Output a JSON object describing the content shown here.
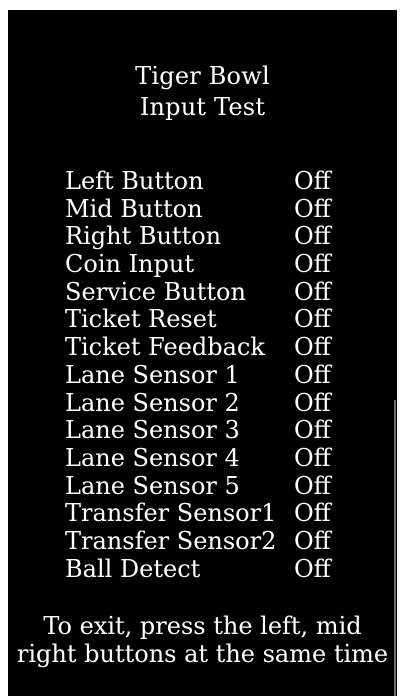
{
  "title": {
    "line1": "Tiger Bowl",
    "line2": "Input Test"
  },
  "inputs": [
    {
      "label": "Left Button",
      "state": "Off"
    },
    {
      "label": "Mid Button",
      "state": "Off"
    },
    {
      "label": "Right Button",
      "state": "Off"
    },
    {
      "label": "Coin Input",
      "state": "Off"
    },
    {
      "label": "Service Button",
      "state": "Off"
    },
    {
      "label": "Ticket Reset",
      "state": "Off"
    },
    {
      "label": "Ticket Feedback",
      "state": "Off"
    },
    {
      "label": "Lane Sensor 1",
      "state": "Off"
    },
    {
      "label": "Lane Sensor 2",
      "state": "Off"
    },
    {
      "label": "Lane Sensor 3",
      "state": "Off"
    },
    {
      "label": "Lane Sensor 4",
      "state": "Off"
    },
    {
      "label": "Lane Sensor 5",
      "state": "Off"
    },
    {
      "label": "Transfer Sensor1",
      "state": "Off"
    },
    {
      "label": "Transfer Sensor2",
      "state": "Off"
    },
    {
      "label": "Ball Detect",
      "state": "Off"
    }
  ],
  "instructions": {
    "line1": "To exit, press the left, mid",
    "line2": "right buttons at the same time"
  },
  "colors": {
    "background": "#000000",
    "text": "#ffffff"
  }
}
